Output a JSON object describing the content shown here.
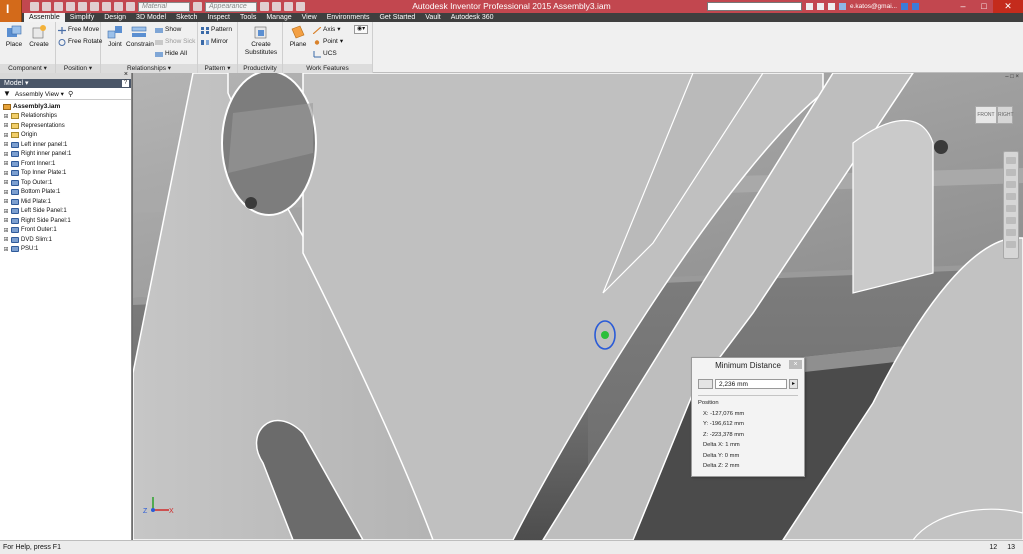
{
  "titlebar": {
    "app_title": "Autodesk Inventor Professional 2015   Assembly3.iam",
    "material_combo": "Material",
    "appearance_combo": "Appearance",
    "user": "e.katos@gmai...",
    "minimize": "–",
    "maximize": "□",
    "close": "✕"
  },
  "tabs": [
    "Assemble",
    "Simplify",
    "Design",
    "3D Model",
    "Sketch",
    "Inspect",
    "Tools",
    "Manage",
    "View",
    "Environments",
    "Get Started",
    "Vault",
    "Autodesk 360"
  ],
  "ribbon": {
    "component": {
      "title": "Component",
      "place": "Place",
      "create": "Create"
    },
    "position": {
      "title": "Position",
      "free_move": "Free Move",
      "free_rotate": "Free Rotate"
    },
    "relationships": {
      "title": "Relationships",
      "joint": "Joint",
      "constrain": "Constrain",
      "show": "Show",
      "show_sick": "Show Sick",
      "hide_all": "Hide All"
    },
    "pattern": {
      "title": "Pattern",
      "pattern": "Pattern",
      "mirror": "Mirror"
    },
    "productivity": {
      "title": "Productivity",
      "create_substitutes": "Create Substitutes"
    },
    "work_features": {
      "title": "Work Features",
      "plane": "Plane",
      "axis": "Axis",
      "point": "Point",
      "ucs": "UCS"
    }
  },
  "browser": {
    "header": "Model",
    "view_mode": "Assembly View",
    "root": "Assembly3.iam",
    "nodes": [
      "Relationships",
      "Representations",
      "Origin",
      "Left inner panel:1",
      "Right inner panel:1",
      "Front Inner:1",
      "Top Inner Plate:1",
      "Top Outer:1",
      "Bottom Plate:1",
      "Mid Plate:1",
      "Left Side Panel:1",
      "Right Side Panel:1",
      "Front Outer:1",
      "DVD Slim:1",
      "PSU:1"
    ]
  },
  "viewcube": {
    "front": "FRONT",
    "right": "RIGHT"
  },
  "min_distance": {
    "title": "Minimum Distance",
    "value": "2,236 mm",
    "position_label": "Position",
    "x": "X: -127,076 mm",
    "y": "Y: -196,612 mm",
    "z": "Z: -223,378 mm",
    "delta_x": "Delta X: 1 mm",
    "delta_y": "Delta Y: 0 mm",
    "delta_z": "Delta Z: 2 mm"
  },
  "statusbar": {
    "help": "For Help, press F1",
    "count1": "12",
    "count2": "13"
  },
  "colors": {
    "titlebar": "#c2474f",
    "app_button": "#d36a1a",
    "tabbar": "#3f3f3f",
    "browser_header": "#4a5668",
    "part_face": "#bdbdbd"
  }
}
